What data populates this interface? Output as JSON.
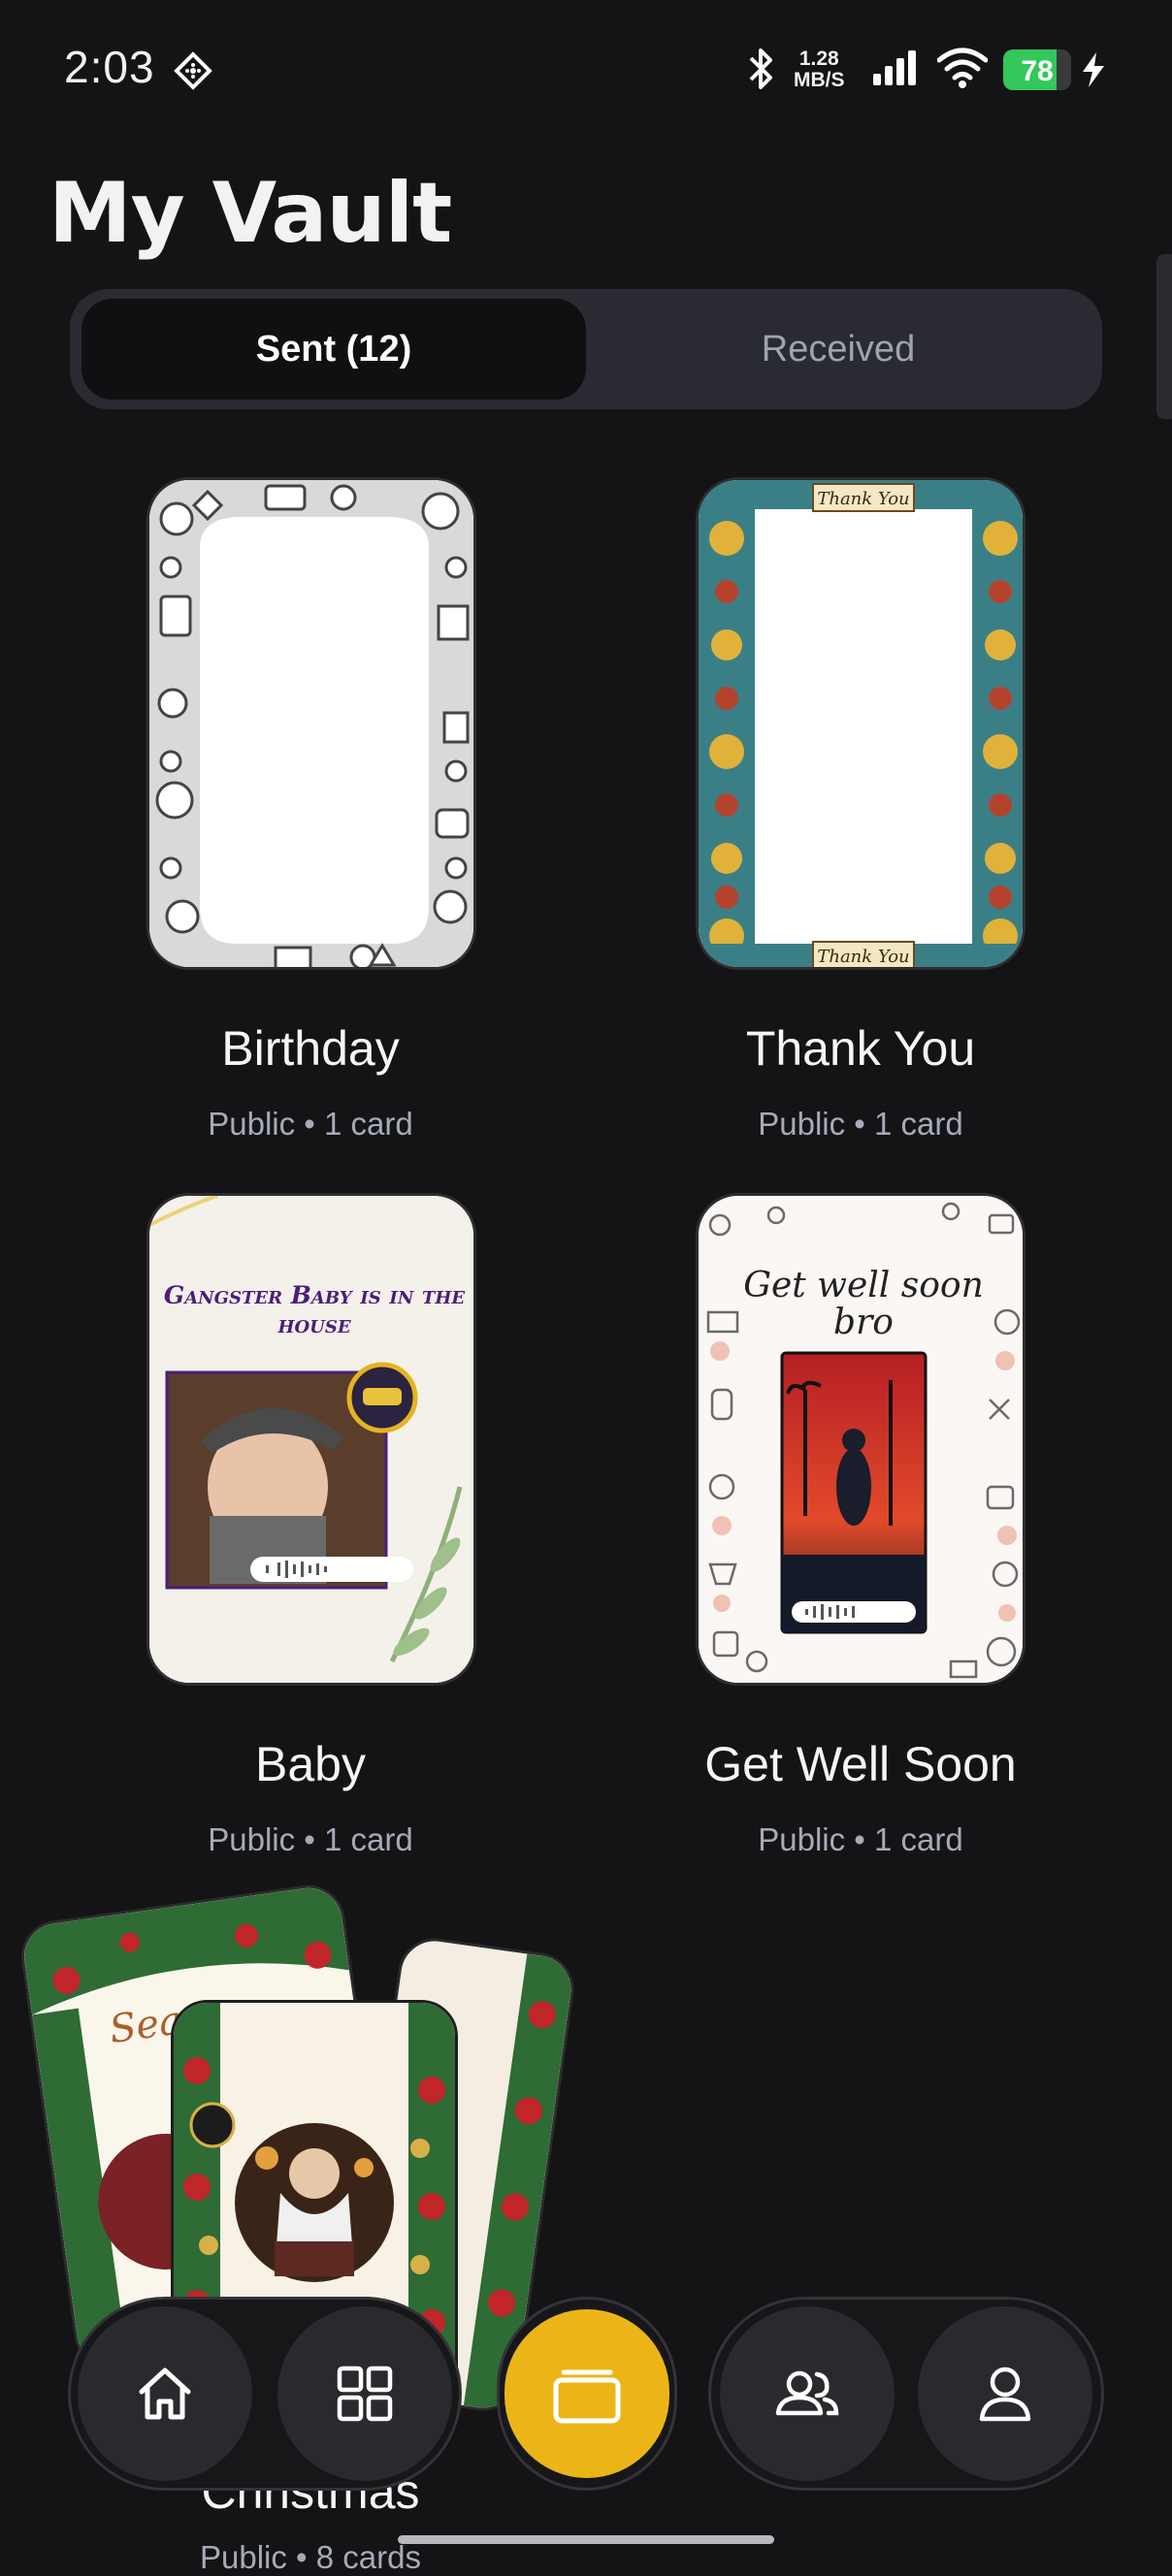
{
  "status_bar": {
    "time": "2:03",
    "speed_top": "1.28",
    "speed_bottom": "MB/S",
    "battery": "78",
    "battery_level": 0.78
  },
  "page": {
    "title": "My Vault"
  },
  "tabs": {
    "sent": "Sent (12)",
    "received": "Received"
  },
  "categories": [
    {
      "name": "Birthday",
      "meta": "Public • 1 card"
    },
    {
      "name": "Thank You",
      "meta": "Public • 1 card",
      "banner": "Thank You"
    },
    {
      "name": "Baby",
      "meta": "Public • 1 card",
      "headline": "Gangster Baby is in the house"
    },
    {
      "name": "Get Well Soon",
      "meta": "Public • 1 card",
      "headline": "Get well soon bro"
    },
    {
      "name": "Christmas",
      "meta": "Public • 8 cards",
      "script": "Seasons"
    }
  ],
  "nav": {
    "items": [
      "home-icon",
      "grid-icon",
      "cards-icon",
      "friends-icon",
      "profile-icon"
    ],
    "active": "cards-icon"
  },
  "colors": {
    "accent": "#ebb518",
    "background": "#141416",
    "segment": "#2a2b32"
  }
}
